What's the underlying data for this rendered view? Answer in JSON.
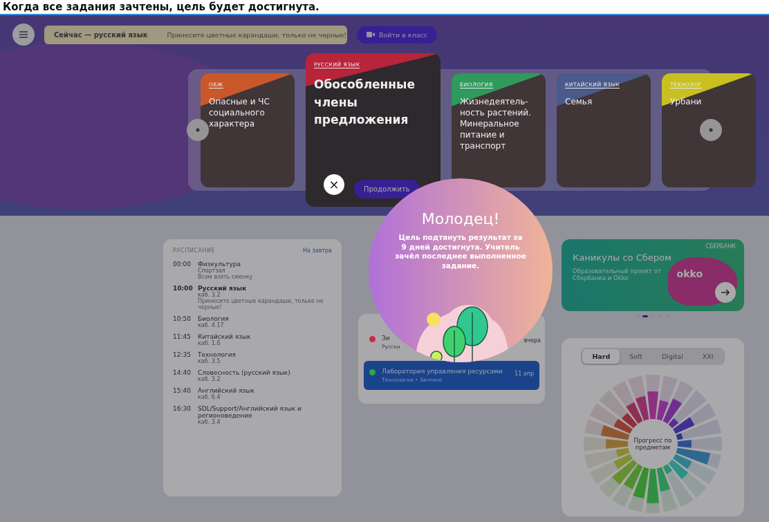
{
  "caption": "Когда все задания зачтены, цель будет достигнута.",
  "top_bar": {
    "now": "Сейчас — русский язык",
    "note": "Принесите цветные карандаши, только не черные!",
    "join_button": "Войти в класс"
  },
  "carousel": {
    "cards": [
      {
        "subject": "ОБЖ",
        "title": "Опасные и ЧС социального характера",
        "featured": false,
        "color": "#c8582a"
      },
      {
        "subject": "РУССКИЙ ЯЗЫК",
        "title": "Обособленные члены предложения",
        "featured": true,
        "color": "#b8243a",
        "button": "Продолжить"
      },
      {
        "subject": "БИОЛОГИЯ",
        "title": "Жизнедеятель-ность растений. Минеральное питание и транспорт",
        "featured": false,
        "color": "#2e9a5c"
      },
      {
        "subject": "КИТАЙСКИЙ ЯЗЫК",
        "title": "Семья",
        "featured": false,
        "color": "#4a5a8a"
      },
      {
        "subject": "ТЕХНОЛОГ",
        "title": "Урбани",
        "featured": false,
        "color": "#c8c020"
      }
    ]
  },
  "schedule": {
    "title": "РАСПИСАНИЕ",
    "link": "На завтра",
    "rows": [
      {
        "time": "00:00",
        "subject": "Физкультура",
        "room": "Спортзал",
        "note": "Всем взять сменку",
        "current": false
      },
      {
        "time": "10:00",
        "subject": "Русский язык",
        "room": "каб. 3.2",
        "note": "Принесите цветные карандаши, только не черные!",
        "current": true
      },
      {
        "time": "10:50",
        "subject": "Биология",
        "room": "каб. 4.17",
        "current": false
      },
      {
        "time": "11:45",
        "subject": "Китайский язык",
        "room": "каб. 1.6",
        "current": false
      },
      {
        "time": "12:35",
        "subject": "Технология",
        "room": "каб. 3.5",
        "current": false
      },
      {
        "time": "14:40",
        "subject": "Словесность (русский язык)",
        "room": "каб. 3.2",
        "current": false
      },
      {
        "time": "15:40",
        "subject": "Английский язык",
        "room": "каб. 6.4",
        "current": false
      },
      {
        "time": "16:30",
        "subject": "SDL/Support/Английский язык и регионоведение",
        "room": "каб. 3.4",
        "current": false
      }
    ]
  },
  "tasks": {
    "items": [
      {
        "title": "Зи",
        "subtitle": "Русски",
        "date": "вчера",
        "color": "#d02848",
        "selected": false
      },
      {
        "title": "Лаборатория управления ресурсами",
        "subtitle": "Технология • Зачтено",
        "date": "11 апр",
        "color": "#2ea84a",
        "selected": true
      }
    ]
  },
  "banner": {
    "title": "Каникулы со Сбером",
    "text": "Образовательный проект от Сбербанка и Okko",
    "logo_1": "СБЕРБАНК",
    "logo_2": "okko",
    "dots": [
      {
        "selected": false
      },
      {
        "selected": true
      },
      {
        "selected": false
      },
      {
        "selected": false
      },
      {
        "selected": false
      }
    ]
  },
  "progress": {
    "tabs": [
      {
        "label": "Hard",
        "selected": true
      },
      {
        "label": "Soft",
        "selected": false
      },
      {
        "label": "Digital",
        "selected": false
      },
      {
        "label": "XXI",
        "selected": false
      }
    ],
    "center_label": "Прогресс по предметам"
  },
  "popup": {
    "title": "Молодец!",
    "message": "Цель подтянуть результат за 9 дней достигнута. Учитель зачёл последнее выполненное задание.",
    "close": "×"
  }
}
